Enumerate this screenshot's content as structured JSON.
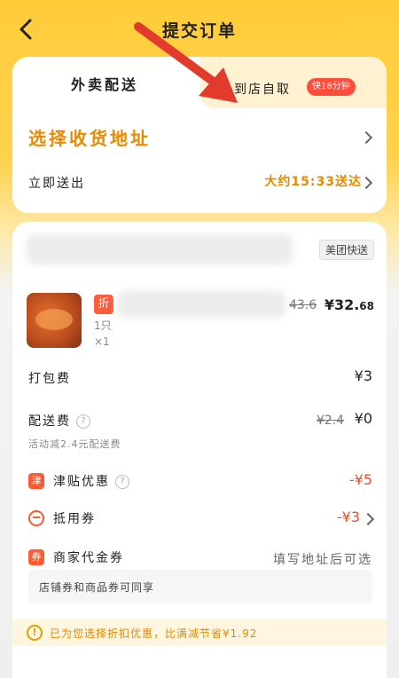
{
  "header": {
    "title": "提交订单"
  },
  "tabs": {
    "delivery": "外卖配送",
    "pickup": "到店自取",
    "pickup_badge": "快18分钟"
  },
  "address": {
    "select_label": "选择收货地址",
    "deliver_label": "立即送出",
    "eta": "大约15:33送达"
  },
  "shop": {
    "delivery_tag": "美团快送"
  },
  "item": {
    "discount_tag": "折",
    "quantity_text": "1只",
    "count": "×1",
    "original_price": "43.6",
    "price_main": "¥32.",
    "price_cents": "68"
  },
  "fees": {
    "packing_label": "打包费",
    "packing_value": "¥3",
    "delivery_label": "配送费",
    "delivery_original": "¥2.4",
    "delivery_value": "¥0",
    "delivery_note": "活动减2.4元配送费",
    "subsidy_icon": "津",
    "subsidy_label": "津贴优惠",
    "subsidy_value": "-¥5",
    "coupon_label": "抵用券",
    "coupon_value": "-¥3",
    "voucher_icon": "券",
    "voucher_label": "商家代金券",
    "voucher_value": "填写地址后可选",
    "note": "店铺券和商品券可同享"
  },
  "tip": {
    "text": "已为您选择折扣优惠，比满减节省¥1.92"
  },
  "colors": {
    "accent": "#e88a00",
    "red": "#ff4a1f",
    "bg_yellow": "#ffcc3a"
  }
}
